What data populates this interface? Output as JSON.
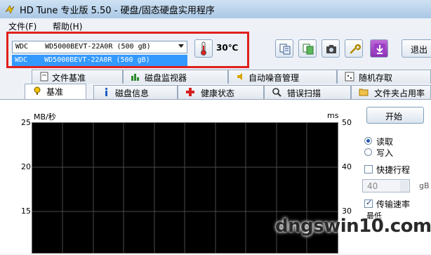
{
  "window": {
    "title": "HD Tune 专业版 5.50 - 硬盘/固态硬盘实用程序"
  },
  "menu": {
    "file": "文件(F)",
    "help": "帮助(H)"
  },
  "toolbar": {
    "drive_selected": "WDC    WD5000BEVT-22A0R (500 gB)",
    "drive_option": "WDC    WD5000BEVT-22A0R (500 gB)",
    "temperature": "30℃",
    "exit_label": "退出"
  },
  "tabs_top": [
    {
      "label": "文件基准",
      "icon": "file-benchmark-icon"
    },
    {
      "label": "磁盘监视器",
      "icon": "disk-monitor-icon"
    },
    {
      "label": "自动噪音管理",
      "icon": "speaker-icon"
    },
    {
      "label": "随机存取",
      "icon": "random-access-icon"
    }
  ],
  "tabs_bottom": [
    {
      "label": "基准",
      "icon": "benchmark-icon",
      "active": true
    },
    {
      "label": "磁盘信息",
      "icon": "info-icon"
    },
    {
      "label": "健康状态",
      "icon": "health-cross-icon"
    },
    {
      "label": "错误扫描",
      "icon": "magnifier-icon"
    },
    {
      "label": "文件夹占用率",
      "icon": "folder-icon"
    }
  ],
  "chart": {
    "left_unit": "MB/秒",
    "right_unit": "ms",
    "left_ticks": [
      "25",
      "20",
      "15"
    ],
    "right_ticks": [
      "50",
      "40",
      "30"
    ]
  },
  "panel": {
    "start_button": "开始",
    "read_label": "读取",
    "write_label": "写入",
    "quick_label": "快捷行程",
    "quick_value": "40",
    "quick_unit": "gB",
    "transfer_label": "传输速率",
    "min_label": "最低"
  },
  "watermark": {
    "text": "dngswin10.com"
  },
  "colors": {
    "highlight": "#e0201c",
    "selection": "#3399ff",
    "chart_bg": "#000000"
  }
}
